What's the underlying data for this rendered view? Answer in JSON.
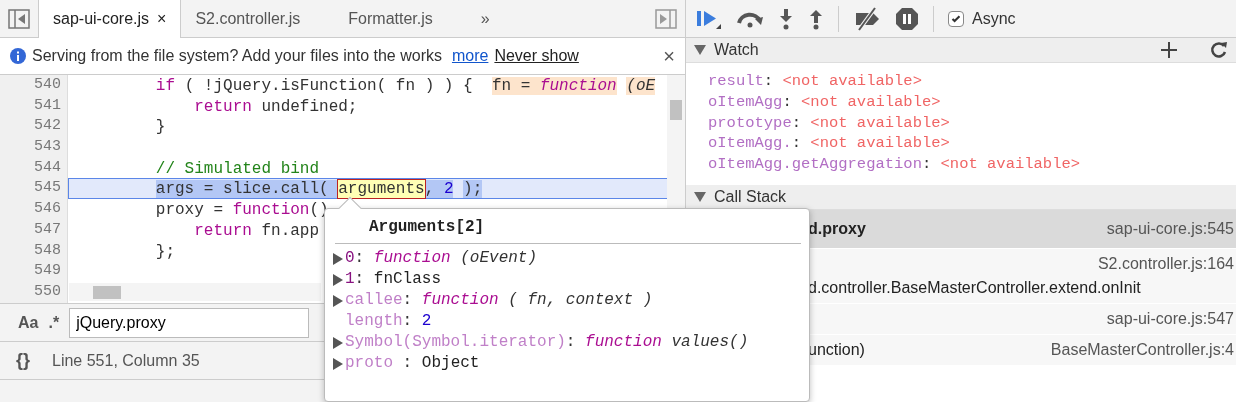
{
  "editor": {
    "tabs": [
      {
        "label": "sap-ui-core.js",
        "selected": true,
        "close": "×"
      },
      {
        "label": "S2.controller.js",
        "selected": false
      },
      {
        "label": "Formatter.js",
        "selected": false
      }
    ],
    "more_tabs": "»",
    "infobar": {
      "message": "Serving from the file system? Add your files into the works",
      "links": [
        "more",
        "Never show"
      ],
      "close": "×"
    },
    "lines": [
      {
        "number": "540",
        "current": false,
        "tokens": [
          {
            "kind": "kw",
            "text": "        if"
          },
          {
            "kind": "plain",
            "text": " ( !jQuery.isFunction( fn ) ) {  "
          },
          {
            "kind": "inline",
            "text": "fn = "
          },
          {
            "kind": "inline_fn",
            "text": "function"
          },
          {
            "kind": "inline_it",
            "text": " (oE"
          }
        ]
      },
      {
        "number": "541",
        "current": false,
        "tokens": [
          {
            "kind": "kw",
            "text": "            return"
          },
          {
            "kind": "plain",
            "text": " undefined;"
          }
        ]
      },
      {
        "number": "542",
        "current": false,
        "tokens": [
          {
            "kind": "plain",
            "text": "        }"
          }
        ]
      },
      {
        "number": "543",
        "current": false
      },
      {
        "number": "544",
        "current": false,
        "tokens": [
          {
            "kind": "comment",
            "text": "        // Simulated bind"
          }
        ]
      },
      {
        "number": "545",
        "current": true,
        "tokens": [
          {
            "kind": "sel",
            "text": "        args = slice.call( "
          },
          {
            "kind": "hover",
            "text": "arguments"
          },
          {
            "kind": "sel",
            "text": ", "
          },
          {
            "kind": "selnum",
            "text": "2"
          },
          {
            "kind": "sel",
            "text": " );"
          }
        ]
      },
      {
        "number": "546",
        "current": false,
        "tokens": [
          {
            "kind": "plain",
            "text": "        proxy = "
          },
          {
            "kind": "kw",
            "text": "function"
          },
          {
            "kind": "plain",
            "text": "()"
          }
        ]
      },
      {
        "number": "547",
        "current": false,
        "tokens": [
          {
            "kind": "kw",
            "text": "            return"
          },
          {
            "kind": "plain",
            "text": " fn.app"
          }
        ]
      },
      {
        "number": "548",
        "current": false,
        "tokens": [
          {
            "kind": "plain",
            "text": "        };"
          }
        ]
      },
      {
        "number": "549",
        "current": false
      },
      {
        "number": "550",
        "current": false
      }
    ],
    "search": {
      "case_toggle": "Aa",
      "regex_toggle": ".*",
      "value": "jQuery.proxy"
    },
    "pretty_print": "{}",
    "status": "Line 551, Column 35"
  },
  "popover": {
    "title": "Arguments[2]",
    "properties": [
      {
        "name": "0",
        "enumerable": true,
        "expandable": true,
        "value": [
          {
            "kind": "punct",
            "text": ": "
          },
          {
            "kind": "fn",
            "text": "function"
          },
          {
            "kind": "it",
            "text": " (oEvent)"
          }
        ]
      },
      {
        "name": "1",
        "enumerable": true,
        "expandable": true,
        "value": [
          {
            "kind": "punct",
            "text": ": "
          },
          {
            "kind": "plain",
            "text": "fnClass"
          }
        ]
      },
      {
        "name": "callee",
        "enumerable": false,
        "expandable": true,
        "value": [
          {
            "kind": "punct",
            "text": ": "
          },
          {
            "kind": "fn",
            "text": "function"
          },
          {
            "kind": "it",
            "text": " ( fn, context )"
          }
        ]
      },
      {
        "name": "length",
        "enumerable": false,
        "expandable": false,
        "value": [
          {
            "kind": "punct",
            "text": ": "
          },
          {
            "kind": "num",
            "text": "2"
          }
        ]
      },
      {
        "name": "Symbol(Symbol.iterator)",
        "enumerable": false,
        "expandable": true,
        "value": [
          {
            "kind": "punct",
            "text": ": "
          },
          {
            "kind": "fn",
            "text": "function"
          },
          {
            "kind": "it",
            "text": " values()"
          }
        ]
      },
      {
        "name": "proto",
        "enumerable": false,
        "expandable": true,
        "value": [
          {
            "kind": "punct",
            "text": " : "
          },
          {
            "kind": "plain",
            "text": "Object"
          }
        ]
      }
    ]
  },
  "debugger": {
    "async": {
      "label": "Async",
      "checked": true
    },
    "watch": {
      "title": "Watch",
      "expanded": true,
      "items": [
        {
          "name": "result",
          "sep": ":",
          "value": "<not available>"
        },
        {
          "name": "oItemAgg",
          "sep": ":",
          "value": "<not available>"
        },
        {
          "name": "prototype",
          "sep": ":",
          "value": "<not available>"
        },
        {
          "name": "oItemAgg.",
          "sep": ":",
          "value": "<not available>"
        },
        {
          "name": "oItemAgg.getAggregation",
          "sep": ":",
          "value": "<not available>"
        }
      ]
    },
    "call_stack": {
      "title": "Call Stack",
      "expanded": true,
      "frames": [
        {
          "name": "d.proxy",
          "location": "sap-ui-core.js:545",
          "selected": true
        },
        {
          "name": "d.controller.BaseMasterController.extend.onInit",
          "location": "S2.controller.js:164",
          "selected": false
        },
        {
          "location": "sap-ui-core.js:547",
          "selected": false
        },
        {
          "name": "unction)",
          "location": "BaseMasterController.js:4",
          "selected": false
        }
      ]
    }
  }
}
